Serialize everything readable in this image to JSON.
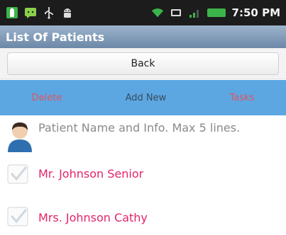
{
  "status_bar": {
    "time": "7:50 PM",
    "icons": [
      "battery-notification-icon",
      "chat-icon",
      "usb-icon",
      "android-icon",
      "wifi-icon",
      "sd-card-icon",
      "signal-icon",
      "battery-icon"
    ]
  },
  "title": "List Of Patients",
  "back_button": "Back",
  "toolbar": {
    "delete": "Delete",
    "add_new": "Add New",
    "tasks": "Tasks"
  },
  "header": {
    "text": "Patient Name and Info. Max 5 lines."
  },
  "patients": [
    "Mr. Johnson Senior",
    "Mrs. Johnson Cathy"
  ],
  "colors": {
    "status_bar_bg": "#1c1c1c",
    "title_bar": "#7d97b4",
    "toolbar_bg": "#5ca7e2",
    "red_action": "#e0545f",
    "patient_name": "#e2246a",
    "green_icon": "#3bb44a"
  }
}
